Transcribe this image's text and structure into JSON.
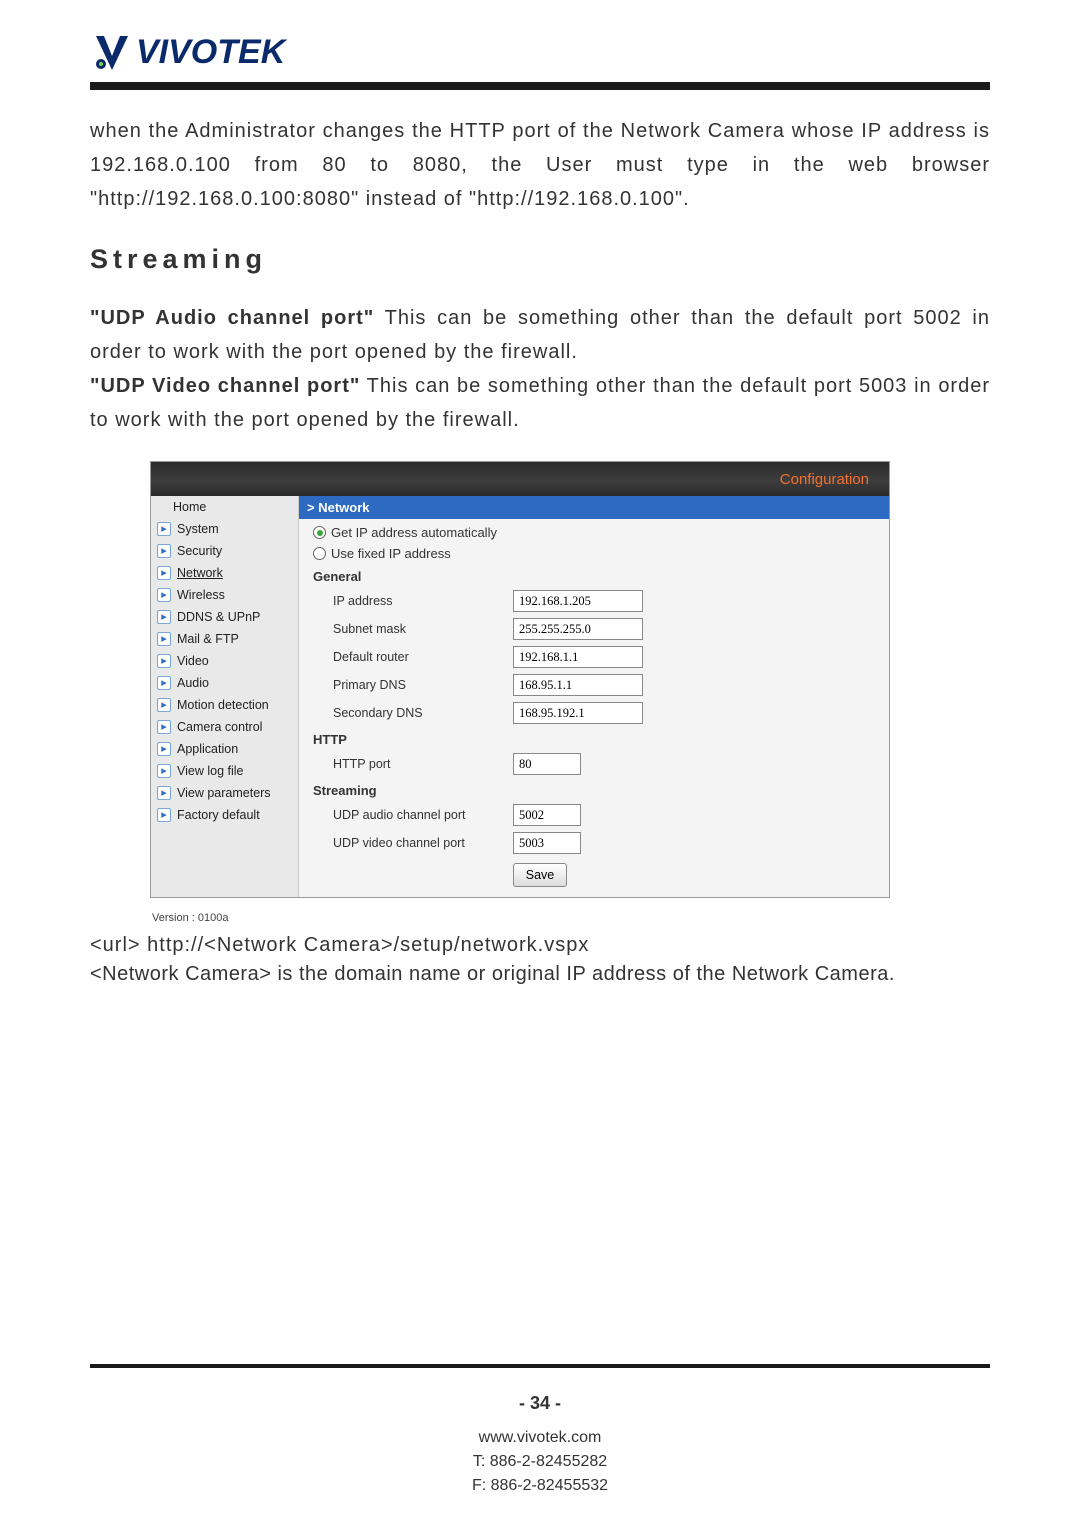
{
  "logo": {
    "text": "VIVOTEK"
  },
  "para1": "when the Administrator changes the HTTP port of the Network Camera whose IP address is 192.168.0.100 from 80 to 8080, the User must type in the web browser \"http://192.168.0.100:8080\" instead of \"http://192.168.0.100\".",
  "section_heading": "Streaming",
  "para2a_bold": "\"UDP Audio channel port\"",
  "para2a_rest": " This can be something other than the default port 5002 in order to work with the port opened by the firewall.",
  "para2b_bold": "\"UDP Video channel port\"",
  "para2b_rest": " This can be something other than the default port 5003 in order to work with the port opened by the firewall.",
  "screenshot": {
    "header": "Configuration",
    "sidebar": {
      "home": "Home",
      "items": [
        "System",
        "Security",
        "Network",
        "Wireless",
        "DDNS & UPnP",
        "Mail & FTP",
        "Video",
        "Audio",
        "Motion detection",
        "Camera control",
        "Application",
        "View log file",
        "View parameters",
        "Factory default"
      ],
      "active_index": 2
    },
    "version": "Version : 0100a",
    "crumb": "> Network",
    "radio1": "Get IP address automatically",
    "radio2": "Use fixed IP address",
    "general_head": "General",
    "fields": {
      "ip_label": "IP address",
      "ip_value": "192.168.1.205",
      "subnet_label": "Subnet mask",
      "subnet_value": "255.255.255.0",
      "router_label": "Default router",
      "router_value": "192.168.1.1",
      "pdns_label": "Primary DNS",
      "pdns_value": "168.95.1.1",
      "sdns_label": "Secondary DNS",
      "sdns_value": "168.95.192.1"
    },
    "http_head": "HTTP",
    "http_port_label": "HTTP port",
    "http_port_value": "80",
    "streaming_head": "Streaming",
    "udp_audio_label": "UDP audio channel port",
    "udp_audio_value": "5002",
    "udp_video_label": "UDP video channel port",
    "udp_video_value": "5003",
    "save_label": "Save"
  },
  "url_line": "<url> http://<Network Camera>/setup/network.vspx",
  "url_desc": "<Network Camera> is the domain name or original IP address of the Network Camera.",
  "footer": {
    "page": "- 34 -",
    "site": "www.vivotek.com",
    "tel": "T: 886-2-82455282",
    "fax": "F: 886-2-82455532"
  }
}
